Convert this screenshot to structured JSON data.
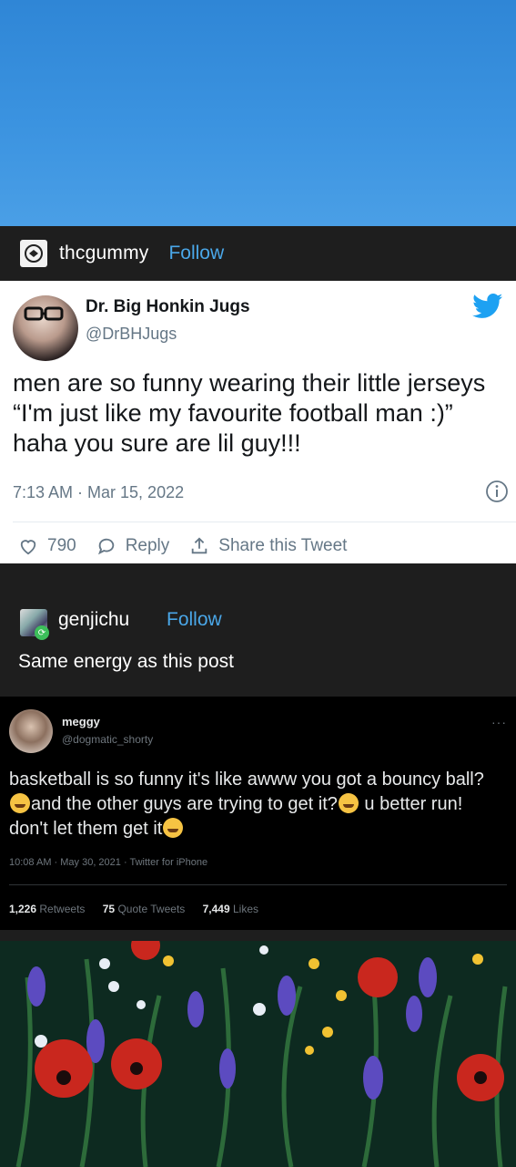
{
  "post": {
    "username": "thcgummy",
    "follow_label": "Follow"
  },
  "tweet1": {
    "display_name": "Dr. Big Honkin Jugs",
    "handle": "@DrBHJugs",
    "text": "men are so funny wearing their little jerseys “I'm just like my favourite football man :)” haha you sure are lil guy!!!",
    "timestamp": "7:13 AM · Mar 15, 2022",
    "like_count": "790",
    "reply_label": "Reply",
    "share_label": "Share this Tweet"
  },
  "reblog": {
    "username": "genjichu",
    "follow_label": "Follow",
    "text": "Same energy as this post"
  },
  "tweet2": {
    "display_name": "meggy",
    "handle": "@dogmatic_shorty",
    "more_label": "···",
    "text_part1": "basketball is so funny it's like awww you got a bouncy ball? ",
    "text_part2": "and the other guys are trying to get it?",
    "text_part3": " u better run! don't let them get it",
    "timestamp": "10:08 AM · May 30, 2021 · Twitter for iPhone",
    "retweets_count": "1,226",
    "retweets_label": "Retweets",
    "quote_count": "75",
    "quote_label": "Quote Tweets",
    "likes_count": "7,449",
    "likes_label": "Likes"
  },
  "colors": {
    "sky": "#3b93e0",
    "tumblr_dark": "#1e1e1e",
    "follow_blue": "#4aa7e8",
    "twitter_blue": "#1da1f2"
  }
}
